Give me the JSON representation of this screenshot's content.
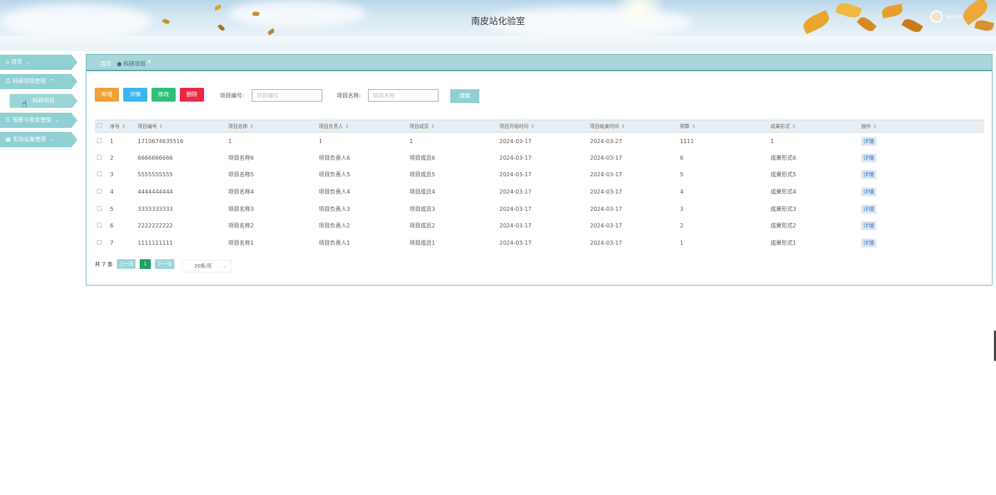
{
  "header": {
    "title": "南皮站化验室",
    "user": "admin"
  },
  "sidebar": {
    "items": [
      {
        "label": "首页",
        "icon": "home-icon",
        "arrow": "⌄"
      },
      {
        "label": "科研项目管理",
        "icon": "list-icon",
        "arrow": "^"
      },
      {
        "label": "预算与资金管理",
        "icon": "list-icon",
        "arrow": "⌄"
      },
      {
        "label": "实验设备管理",
        "icon": "device-icon",
        "arrow": "⌄"
      }
    ],
    "sub_item": "科研项目"
  },
  "tabs": {
    "home": "首页",
    "active": "科研项目",
    "close": "×"
  },
  "toolbar": {
    "add": "新增",
    "detail": "详情",
    "edit": "修改",
    "delete": "删除",
    "code_label": "项目编号:",
    "code_placeholder": "项目编号",
    "name_label": "项目名称:",
    "name_placeholder": "项目名称",
    "search": "搜索"
  },
  "table": {
    "headers": [
      "序号",
      "项目编号",
      "项目名称",
      "项目负责人",
      "项目成员",
      "项目开始时间",
      "项目结束时间",
      "预算",
      "成果形式",
      "操作"
    ],
    "rows": [
      [
        "1",
        "1710674635516",
        "1",
        "1",
        "1",
        "2024-03-17",
        "2024-03-27",
        "1111",
        "1",
        "详情"
      ],
      [
        "2",
        "6666666666",
        "项目名称6",
        "项目负责人6",
        "项目成员6",
        "2024-03-17",
        "2024-03-17",
        "6",
        "成果形式6",
        "详情"
      ],
      [
        "3",
        "5555555555",
        "项目名称5",
        "项目负责人5",
        "项目成员5",
        "2024-03-17",
        "2024-03-17",
        "5",
        "成果形式5",
        "详情"
      ],
      [
        "4",
        "4444444444",
        "项目名称4",
        "项目负责人4",
        "项目成员4",
        "2024-03-17",
        "2024-03-17",
        "4",
        "成果形式4",
        "详情"
      ],
      [
        "5",
        "3333333333",
        "项目名称3",
        "项目负责人3",
        "项目成员3",
        "2024-03-17",
        "2024-03-17",
        "3",
        "成果形式3",
        "详情"
      ],
      [
        "6",
        "2222222222",
        "项目名称2",
        "项目负责人2",
        "项目成员2",
        "2024-03-17",
        "2024-03-17",
        "2",
        "成果形式2",
        "详情"
      ],
      [
        "7",
        "1111111111",
        "项目名称1",
        "项目负责人1",
        "项目成员1",
        "2024-03-17",
        "2024-03-17",
        "1",
        "成果形式1",
        "详情"
      ]
    ]
  },
  "pagination": {
    "total": "共 7 条",
    "prev": "上一页",
    "current": "1",
    "next": "下一页",
    "page_size": "20条/页"
  },
  "colors": {
    "accent": "#8fd0d3",
    "add": "#f0a035",
    "detail": "#3cb4f0",
    "edit": "#2ec07a",
    "delete": "#e82a45",
    "current_page": "#1ba068"
  }
}
